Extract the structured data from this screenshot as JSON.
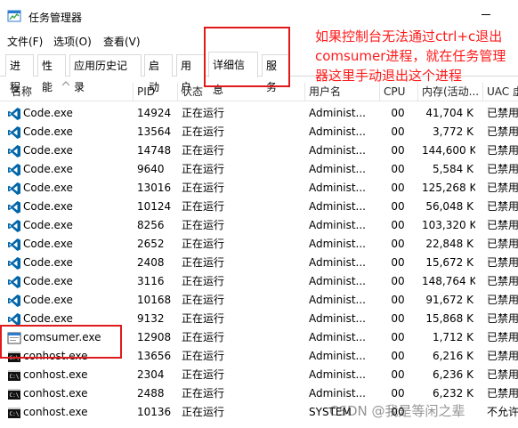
{
  "window": {
    "title": "任务管理器"
  },
  "menu": [
    {
      "label": "文件(F)"
    },
    {
      "label": "选项(O)"
    },
    {
      "label": "查看(V)"
    }
  ],
  "tabs": [
    {
      "label": "进程",
      "active": false
    },
    {
      "label": "性能",
      "active": false
    },
    {
      "label": "应用历史记录",
      "active": false
    },
    {
      "label": "启动",
      "active": false
    },
    {
      "label": "用户",
      "active": false
    },
    {
      "label": "详细信息",
      "active": true
    },
    {
      "label": "服务",
      "active": false
    }
  ],
  "columns": {
    "name": "名称",
    "pid": "PID",
    "status": "状态",
    "user": "用户名",
    "cpu": "CPU",
    "mem": "内存(活动...",
    "uac": "UAC 虚"
  },
  "rows": [
    {
      "icon": "vscode-icon",
      "name": "Code.exe",
      "pid": "14924",
      "status": "正在运行",
      "user": "Administ...",
      "cpu": "00",
      "mem": "41,704 K",
      "uac": "已禁用"
    },
    {
      "icon": "vscode-icon",
      "name": "Code.exe",
      "pid": "13564",
      "status": "正在运行",
      "user": "Administ...",
      "cpu": "00",
      "mem": "3,772 K",
      "uac": "已禁用"
    },
    {
      "icon": "vscode-icon",
      "name": "Code.exe",
      "pid": "14748",
      "status": "正在运行",
      "user": "Administ...",
      "cpu": "00",
      "mem": "144,600 K",
      "uac": "已禁用"
    },
    {
      "icon": "vscode-icon",
      "name": "Code.exe",
      "pid": "9640",
      "status": "正在运行",
      "user": "Administ...",
      "cpu": "00",
      "mem": "5,584 K",
      "uac": "已禁用"
    },
    {
      "icon": "vscode-icon",
      "name": "Code.exe",
      "pid": "13016",
      "status": "正在运行",
      "user": "Administ...",
      "cpu": "00",
      "mem": "125,268 K",
      "uac": "已禁用"
    },
    {
      "icon": "vscode-icon",
      "name": "Code.exe",
      "pid": "10124",
      "status": "正在运行",
      "user": "Administ...",
      "cpu": "00",
      "mem": "56,048 K",
      "uac": "已禁用"
    },
    {
      "icon": "vscode-icon",
      "name": "Code.exe",
      "pid": "8256",
      "status": "正在运行",
      "user": "Administ...",
      "cpu": "00",
      "mem": "103,320 K",
      "uac": "已禁用"
    },
    {
      "icon": "vscode-icon",
      "name": "Code.exe",
      "pid": "2652",
      "status": "正在运行",
      "user": "Administ...",
      "cpu": "00",
      "mem": "22,848 K",
      "uac": "已禁用"
    },
    {
      "icon": "vscode-icon",
      "name": "Code.exe",
      "pid": "2408",
      "status": "正在运行",
      "user": "Administ...",
      "cpu": "00",
      "mem": "15,672 K",
      "uac": "已禁用"
    },
    {
      "icon": "vscode-icon",
      "name": "Code.exe",
      "pid": "3116",
      "status": "正在运行",
      "user": "Administ...",
      "cpu": "00",
      "mem": "148,764 K",
      "uac": "已禁用"
    },
    {
      "icon": "vscode-icon",
      "name": "Code.exe",
      "pid": "10168",
      "status": "正在运行",
      "user": "Administ...",
      "cpu": "00",
      "mem": "91,672 K",
      "uac": "已禁用"
    },
    {
      "icon": "vscode-icon",
      "name": "Code.exe",
      "pid": "9132",
      "status": "正在运行",
      "user": "Administ...",
      "cpu": "00",
      "mem": "15,868 K",
      "uac": "已禁用"
    },
    {
      "icon": "app-window-icon",
      "name": "comsumer.exe",
      "pid": "12908",
      "status": "正在运行",
      "user": "Administ...",
      "cpu": "00",
      "mem": "1,712 K",
      "uac": "已禁用"
    },
    {
      "icon": "console-icon",
      "name": "conhost.exe",
      "pid": "13656",
      "status": "正在运行",
      "user": "Administ...",
      "cpu": "00",
      "mem": "6,216 K",
      "uac": "已禁用"
    },
    {
      "icon": "console-icon",
      "name": "conhost.exe",
      "pid": "2304",
      "status": "正在运行",
      "user": "Administ...",
      "cpu": "00",
      "mem": "6,236 K",
      "uac": "已禁用"
    },
    {
      "icon": "console-icon",
      "name": "conhost.exe",
      "pid": "2488",
      "status": "正在运行",
      "user": "Administ...",
      "cpu": "00",
      "mem": "6,232 K",
      "uac": "已禁用"
    },
    {
      "icon": "console-icon",
      "name": "conhost.exe",
      "pid": "10136",
      "status": "正在运行",
      "user": "SYSTEM",
      "cpu": "00",
      "mem": "",
      "uac": "不允许"
    }
  ],
  "annotation": {
    "text": "如果控制台无法通过ctrl+c退出comsumer进程，就在任务管理器这里手动退出这个进程",
    "color": "#ff1a1a"
  },
  "watermark": "CSDN @我是等闲之辈",
  "colors": {
    "vscode_blue": "#0065a9",
    "highlight_red": "#e0191b"
  }
}
